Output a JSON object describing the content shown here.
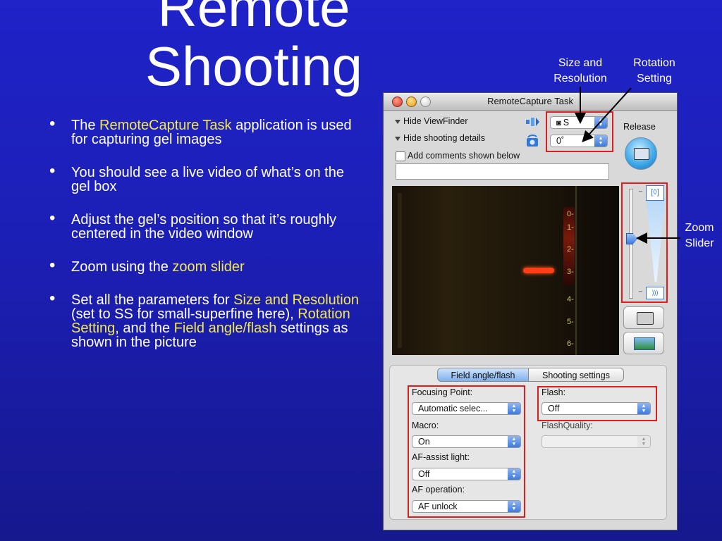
{
  "slide": {
    "title_line1": "Remote",
    "title_line2": "Shooting",
    "bullets": [
      {
        "pre": "The ",
        "hl": "RemoteCapture Task",
        "post": " application is used for capturing gel images"
      },
      {
        "text": "You should see a live video of what’s on the gel box"
      },
      {
        "text": "Adjust the gel’s position so that it’s roughly centered in the video window"
      },
      {
        "pre": "Zoom using the ",
        "hl": "zoom slider",
        "post": ""
      },
      {
        "parts": [
          {
            "t": "Set all the parameters for ",
            "h": false
          },
          {
            "t": "Size and Resolution",
            "h": true
          },
          {
            "t": " (set to SS for small-superfine here), ",
            "h": false
          },
          {
            "t": "Rotation Setting",
            "h": true
          },
          {
            "t": ", and the ",
            "h": false
          },
          {
            "t": "Field angle/flash",
            "h": true
          },
          {
            "t": " settings as shown in the picture",
            "h": false
          }
        ]
      }
    ],
    "highlight_color": "#f2e84a",
    "background_color": "#1c1fb5"
  },
  "callouts": {
    "size_resolution": "Size and Resolution",
    "rotation": "Rotation Setting",
    "zoom": "Zoom Slider"
  },
  "window": {
    "title": "RemoteCapture Task",
    "hide_viewfinder": "Hide ViewFinder",
    "hide_shooting": "Hide shooting details",
    "add_comments": "Add comments shown below",
    "size_value": "S",
    "rotation_value": "0˚",
    "release_label": "Release",
    "ruler_ticks": [
      "0-",
      "1-",
      "2-",
      "3-",
      "4-",
      "5-",
      "6-"
    ],
    "tabs": [
      "Field angle/flash",
      "Shooting settings"
    ],
    "fields": {
      "focusing_label": "Focusing Point:",
      "focusing_value": "Automatic selec...",
      "macro_label": "Macro:",
      "macro_value": "On",
      "af_assist_label": "AF-assist light:",
      "af_assist_value": "Off",
      "af_operation_label": "AF operation:",
      "af_operation_value": "AF unlock",
      "flash_label": "Flash:",
      "flash_value": "Off",
      "flash_quality_label": "FlashQuality:",
      "flash_quality_value": ""
    },
    "accent_red": "#e01c1c",
    "accent_blue": "#3d7be0"
  }
}
